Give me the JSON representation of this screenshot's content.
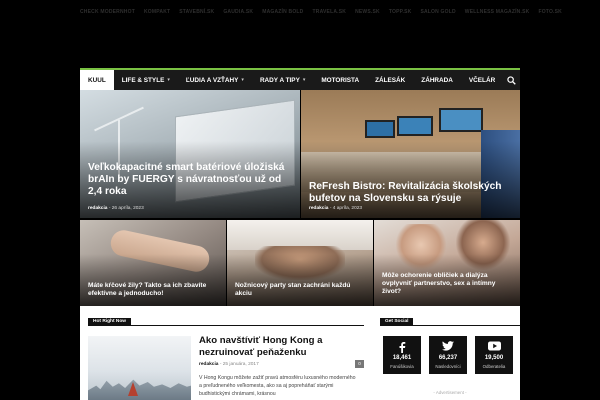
{
  "top_bar": {
    "links": [
      "CHECK MODERNHOT",
      "KOMPAKT",
      "STAVEBNÍ.SK",
      "GAUDIA.SK",
      "MAGAZÍN BOLD",
      "TRAVELA.SK",
      "NEWS.SK",
      "TOPP.SK",
      "SALON GOLD",
      "WELLNESS MAGAZÍN.SK",
      "FOTO.SK"
    ]
  },
  "nav": {
    "items": [
      {
        "label": "KUUL",
        "active": true,
        "dropdown": false
      },
      {
        "label": "LIFE & STYLE",
        "active": false,
        "dropdown": true
      },
      {
        "label": "ĽUDIA A VZŤAHY",
        "active": false,
        "dropdown": true
      },
      {
        "label": "RADY A TIPY",
        "active": false,
        "dropdown": true
      },
      {
        "label": "MOTORISTA",
        "active": false,
        "dropdown": false
      },
      {
        "label": "ZÁLESÁK",
        "active": false,
        "dropdown": false
      },
      {
        "label": "ZÁHRADA",
        "active": false,
        "dropdown": false
      },
      {
        "label": "VČELÁR",
        "active": false,
        "dropdown": false
      }
    ],
    "search_icon": "search-icon"
  },
  "featured": [
    {
      "title": "Veľkokapacitné smart batériové úložiská brAIn by FUERGY s návratnosťou už od 2,4 roka",
      "author": "redakcia",
      "date": "26 apríla, 2023"
    },
    {
      "title": "ReFresh Bistro: Revitalizácia školských bufetov na Slovensku sa rýsuje",
      "author": "redakcia",
      "date": "4 apríla, 2023"
    },
    {
      "title": "Máte kŕčové žily? Takto sa ich zbavíte efektívne a jednoducho!"
    },
    {
      "title": "Nožnicový party stan zachráni každú akciu"
    },
    {
      "title": "Môže ochorenie obličiek a dialýza ovplyvniť partnerstvo, sex a intímny život?"
    }
  ],
  "hot_right_now": {
    "heading": "Hot Right Now",
    "article": {
      "title": "Ako navštíviť Hong Kong a nezruinovať peňaženku",
      "author": "redakcia",
      "date": "25 januára, 2017",
      "comments": "0",
      "excerpt": "V Hong Kongu môžete zažiť pravú atmosféru luxusného moderného a preľudneného veľkomesta, ako sa aj popreháňať starými budhistickými chrámami, krásnou"
    }
  },
  "get_social": {
    "heading": "Get Social",
    "items": [
      {
        "icon": "facebook-icon",
        "count": "18,461",
        "label": "Fanúšikovia"
      },
      {
        "icon": "twitter-icon",
        "count": "66,237",
        "label": "Nasledovníci"
      },
      {
        "icon": "youtube-icon",
        "count": "19,500",
        "label": "Odberatelia"
      }
    ],
    "advertisement": "- Advertisement -"
  },
  "colors": {
    "accent": "#7ac143",
    "background": "#000000",
    "nav": "#1a1a1a"
  }
}
